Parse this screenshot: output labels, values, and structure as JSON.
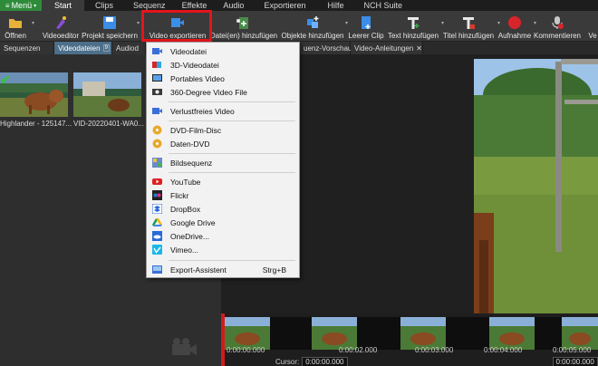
{
  "menubar": {
    "menu_label": "Menü",
    "tabs": [
      "Start",
      "Clips",
      "Sequenz",
      "Effekte",
      "Audio",
      "Exportieren",
      "Hilfe",
      "NCH Suite"
    ]
  },
  "toolbar": {
    "open": "Öffnen",
    "video_editor": "Videoeditor",
    "save_project": "Projekt speichern",
    "export_video": "Video exportieren",
    "add_files": "Datei(en) hinzufügen",
    "add_objects": "Objekte hinzufügen",
    "blank_clip": "Leerer Clip",
    "add_text": "Text hinzufügen",
    "add_title": "Titel hinzufügen",
    "recording": "Aufnahme",
    "comments": "Kommentieren"
  },
  "tabrow": {
    "sequences": "Sequenzen",
    "video_files": "Videodateien",
    "video_files_count": "9",
    "audio_files": "Audiod",
    "sequence_preview": "uenz-Vorschau",
    "video_tutorials": "Video-Anleitungen"
  },
  "bin": {
    "clips": [
      {
        "caption": "Highlander - 125147..."
      },
      {
        "caption": "VID-20220401-WA0..."
      }
    ]
  },
  "timeline": {
    "ticks": [
      "0:00:00.000",
      "0:00:02.000",
      "0:00:03.000",
      "0:00:04.000",
      "0:00:05.000"
    ],
    "cursor_label": "Cursor:",
    "cursor_value": "0:00:00.000",
    "end_value": "0:00:00.000"
  },
  "export_menu": {
    "items": [
      {
        "label": "Videodatei",
        "icon": "video-file-icon"
      },
      {
        "label": "3D-Videodatei",
        "icon": "3d-video-icon"
      },
      {
        "label": "Portables Video",
        "icon": "portable-video-icon"
      },
      {
        "label": "360-Degree Video File",
        "icon": "360-video-icon"
      },
      {
        "label": "Verlustfreies Video",
        "icon": "lossless-video-icon"
      },
      {
        "label": "DVD-Film-Disc",
        "icon": "dvd-icon"
      },
      {
        "label": "Daten-DVD",
        "icon": "data-dvd-icon"
      },
      {
        "label": "Bildsequenz",
        "icon": "image-sequence-icon"
      },
      {
        "label": "YouTube",
        "icon": "youtube-icon"
      },
      {
        "label": "Flickr",
        "icon": "flickr-icon"
      },
      {
        "label": "DropBox",
        "icon": "dropbox-icon"
      },
      {
        "label": "Google Drive",
        "icon": "google-drive-icon"
      },
      {
        "label": "OneDrive...",
        "icon": "onedrive-icon"
      },
      {
        "label": "Vimeo...",
        "icon": "vimeo-icon"
      },
      {
        "label": "Export-Assistent",
        "icon": "export-wizard-icon",
        "shortcut": "Strg+B"
      }
    ]
  },
  "colors": {
    "accent_green": "#2e8b3a",
    "highlight_red": "#e4141b",
    "selected_tab": "#4d6f8a"
  }
}
